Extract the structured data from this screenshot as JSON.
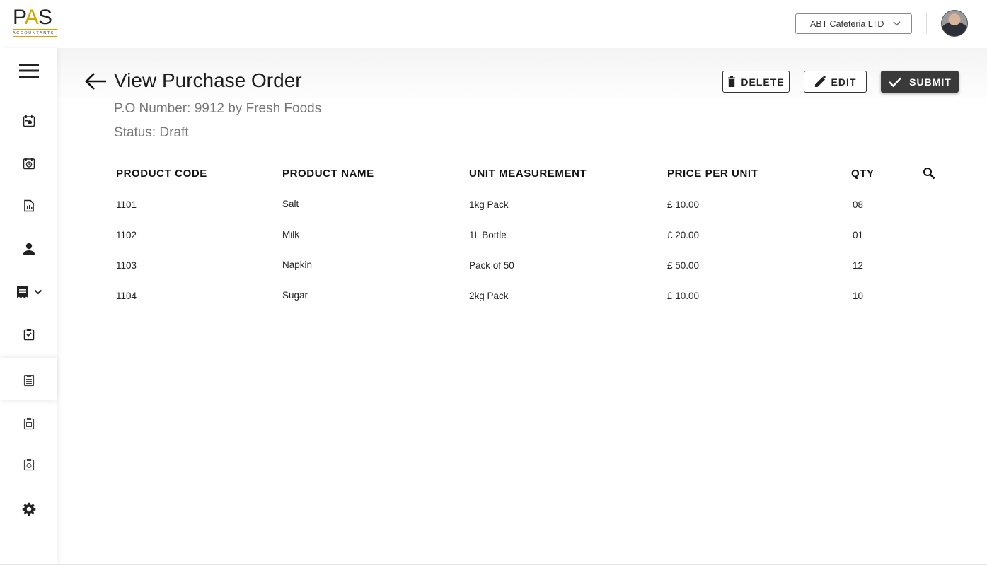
{
  "header": {
    "logo_main": "PAS",
    "logo_sub": "ACCOUNTANTS",
    "company_selected": "ABT Cafeteria LTD"
  },
  "page": {
    "title": "View Purchase Order",
    "po_number": "P.O Number: 9912 by Fresh Foods",
    "status": "Status: Draft"
  },
  "actions": {
    "delete_label": "DELETE",
    "edit_label": "EDIT",
    "submit_label": "SUBMIT"
  },
  "table": {
    "columns": [
      "PRODUCT CODE",
      "PRODUCT NAME",
      "UNIT MEASUREMENT",
      "PRICE PER UNIT",
      "QTY"
    ],
    "rows": [
      [
        "1101",
        "Salt",
        "1kg Pack",
        "£ 10.00",
        "08"
      ],
      [
        "1102",
        "Milk",
        "1L Bottle",
        "£ 20.00",
        "01"
      ],
      [
        "1103",
        "Napkin",
        "Pack of 50",
        "£ 50.00",
        "12"
      ],
      [
        "1104",
        "Sugar",
        "2kg Pack",
        "£ 10.00",
        "10"
      ]
    ]
  },
  "colors": {
    "accent_gold": "#d9a400",
    "submit_bg": "#3a3a3a"
  },
  "icons": {
    "menu": "hamburger-menu-icon",
    "sidebar": [
      "calendar-task-icon",
      "calendar-clock-icon",
      "report-chart-icon",
      "user-icon",
      "receipt-icon",
      "clipboard-icon",
      "clipboard-list-icon",
      "clipboard-icon",
      "clipboard-icon",
      "gear-icon"
    ]
  }
}
